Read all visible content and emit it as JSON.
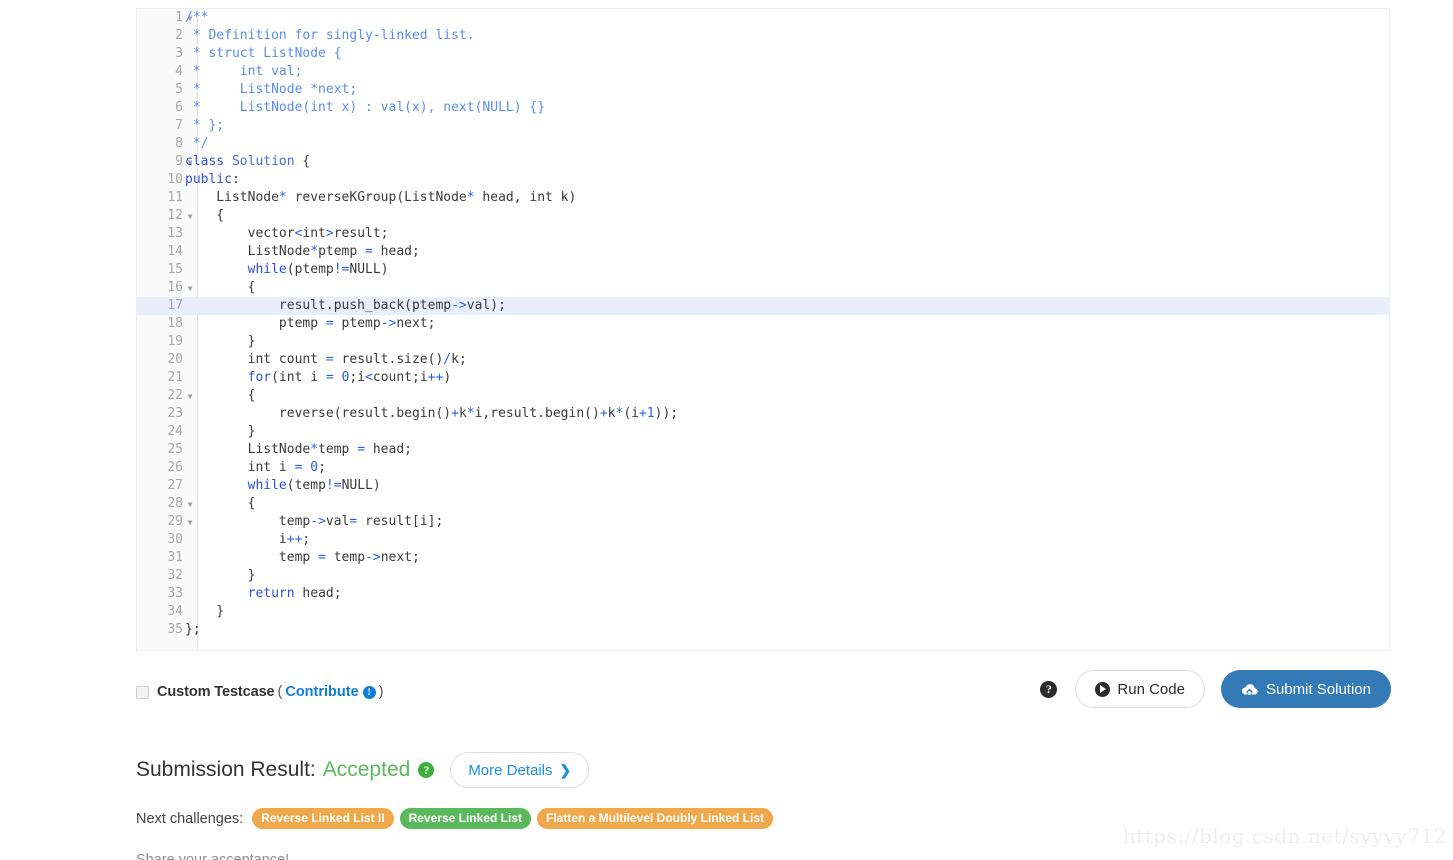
{
  "editor": {
    "language": "cpp",
    "active_line": 17,
    "lines": [
      {
        "n": 1,
        "fold": true,
        "tokens": [
          {
            "t": "/**",
            "c": "cmt"
          }
        ]
      },
      {
        "n": 2,
        "fold": false,
        "tokens": [
          {
            "t": " * Definition for singly-linked list.",
            "c": "cmt"
          }
        ]
      },
      {
        "n": 3,
        "fold": false,
        "tokens": [
          {
            "t": " * struct ListNode {",
            "c": "cmt"
          }
        ]
      },
      {
        "n": 4,
        "fold": false,
        "tokens": [
          {
            "t": " *     int val;",
            "c": "cmt"
          }
        ]
      },
      {
        "n": 5,
        "fold": false,
        "tokens": [
          {
            "t": " *     ListNode *next;",
            "c": "cmt"
          }
        ]
      },
      {
        "n": 6,
        "fold": false,
        "tokens": [
          {
            "t": " *     ListNode(int x) : val(x), next(NULL) {}",
            "c": "cmt"
          }
        ]
      },
      {
        "n": 7,
        "fold": false,
        "tokens": [
          {
            "t": " * };",
            "c": "cmt"
          }
        ]
      },
      {
        "n": 8,
        "fold": false,
        "tokens": [
          {
            "t": " */",
            "c": "cmt"
          }
        ]
      },
      {
        "n": 9,
        "fold": true,
        "tokens": [
          {
            "t": "class",
            "c": "kw"
          },
          {
            "t": " ",
            "c": "pln"
          },
          {
            "t": "Solution",
            "c": "cls"
          },
          {
            "t": " {",
            "c": "pln"
          }
        ]
      },
      {
        "n": 10,
        "fold": false,
        "tokens": [
          {
            "t": "public",
            "c": "kw"
          },
          {
            "t": ":",
            "c": "pln"
          }
        ]
      },
      {
        "n": 11,
        "fold": false,
        "tokens": [
          {
            "t": "    ListNode",
            "c": "pln"
          },
          {
            "t": "*",
            "c": "op"
          },
          {
            "t": " reverseKGroup(ListNode",
            "c": "pln"
          },
          {
            "t": "*",
            "c": "op"
          },
          {
            "t": " head, int k)",
            "c": "pln"
          }
        ]
      },
      {
        "n": 12,
        "fold": true,
        "tokens": [
          {
            "t": "    {",
            "c": "pln"
          }
        ]
      },
      {
        "n": 13,
        "fold": false,
        "tokens": [
          {
            "t": "        vector",
            "c": "pln"
          },
          {
            "t": "<",
            "c": "op"
          },
          {
            "t": "int",
            "c": "pln"
          },
          {
            "t": ">",
            "c": "op"
          },
          {
            "t": "result;",
            "c": "pln"
          }
        ]
      },
      {
        "n": 14,
        "fold": false,
        "tokens": [
          {
            "t": "        ListNode",
            "c": "pln"
          },
          {
            "t": "*",
            "c": "op"
          },
          {
            "t": "ptemp ",
            "c": "pln"
          },
          {
            "t": "=",
            "c": "op"
          },
          {
            "t": " head;",
            "c": "pln"
          }
        ]
      },
      {
        "n": 15,
        "fold": false,
        "tokens": [
          {
            "t": "        ",
            "c": "pln"
          },
          {
            "t": "while",
            "c": "kw"
          },
          {
            "t": "(ptemp",
            "c": "pln"
          },
          {
            "t": "!=",
            "c": "op"
          },
          {
            "t": "NULL)",
            "c": "pln"
          }
        ]
      },
      {
        "n": 16,
        "fold": true,
        "tokens": [
          {
            "t": "        {",
            "c": "pln"
          }
        ]
      },
      {
        "n": 17,
        "fold": false,
        "tokens": [
          {
            "t": "            result.push_back(ptemp",
            "c": "pln"
          },
          {
            "t": "->",
            "c": "op"
          },
          {
            "t": "val);",
            "c": "pln"
          }
        ]
      },
      {
        "n": 18,
        "fold": false,
        "tokens": [
          {
            "t": "            ptemp ",
            "c": "pln"
          },
          {
            "t": "=",
            "c": "op"
          },
          {
            "t": " ptemp",
            "c": "pln"
          },
          {
            "t": "->",
            "c": "op"
          },
          {
            "t": "next;",
            "c": "pln"
          }
        ]
      },
      {
        "n": 19,
        "fold": false,
        "tokens": [
          {
            "t": "        }",
            "c": "pln"
          }
        ]
      },
      {
        "n": 20,
        "fold": false,
        "tokens": [
          {
            "t": "        int count ",
            "c": "pln"
          },
          {
            "t": "=",
            "c": "op"
          },
          {
            "t": " result.size()",
            "c": "pln"
          },
          {
            "t": "/",
            "c": "op"
          },
          {
            "t": "k;",
            "c": "pln"
          }
        ]
      },
      {
        "n": 21,
        "fold": false,
        "tokens": [
          {
            "t": "        ",
            "c": "pln"
          },
          {
            "t": "for",
            "c": "kw"
          },
          {
            "t": "(int i ",
            "c": "pln"
          },
          {
            "t": "=",
            "c": "op"
          },
          {
            "t": " ",
            "c": "pln"
          },
          {
            "t": "0",
            "c": "num"
          },
          {
            "t": ";i",
            "c": "pln"
          },
          {
            "t": "<",
            "c": "op"
          },
          {
            "t": "count;i",
            "c": "pln"
          },
          {
            "t": "++",
            "c": "op"
          },
          {
            "t": ")",
            "c": "pln"
          }
        ]
      },
      {
        "n": 22,
        "fold": true,
        "tokens": [
          {
            "t": "        {",
            "c": "pln"
          }
        ]
      },
      {
        "n": 23,
        "fold": false,
        "tokens": [
          {
            "t": "            reverse(result.begin()",
            "c": "pln"
          },
          {
            "t": "+",
            "c": "op"
          },
          {
            "t": "k",
            "c": "pln"
          },
          {
            "t": "*",
            "c": "op"
          },
          {
            "t": "i,result.begin()",
            "c": "pln"
          },
          {
            "t": "+",
            "c": "op"
          },
          {
            "t": "k",
            "c": "pln"
          },
          {
            "t": "*",
            "c": "op"
          },
          {
            "t": "(i",
            "c": "pln"
          },
          {
            "t": "+",
            "c": "op"
          },
          {
            "t": "1",
            "c": "num"
          },
          {
            "t": "));",
            "c": "pln"
          }
        ]
      },
      {
        "n": 24,
        "fold": false,
        "tokens": [
          {
            "t": "        }",
            "c": "pln"
          }
        ]
      },
      {
        "n": 25,
        "fold": false,
        "tokens": [
          {
            "t": "        ListNode",
            "c": "pln"
          },
          {
            "t": "*",
            "c": "op"
          },
          {
            "t": "temp ",
            "c": "pln"
          },
          {
            "t": "=",
            "c": "op"
          },
          {
            "t": " head;",
            "c": "pln"
          }
        ]
      },
      {
        "n": 26,
        "fold": false,
        "tokens": [
          {
            "t": "        int i ",
            "c": "pln"
          },
          {
            "t": "=",
            "c": "op"
          },
          {
            "t": " ",
            "c": "pln"
          },
          {
            "t": "0",
            "c": "num"
          },
          {
            "t": ";",
            "c": "pln"
          }
        ]
      },
      {
        "n": 27,
        "fold": false,
        "tokens": [
          {
            "t": "        ",
            "c": "pln"
          },
          {
            "t": "while",
            "c": "kw"
          },
          {
            "t": "(temp",
            "c": "pln"
          },
          {
            "t": "!=",
            "c": "op"
          },
          {
            "t": "NULL)",
            "c": "pln"
          }
        ]
      },
      {
        "n": 28,
        "fold": true,
        "tokens": [
          {
            "t": "        {",
            "c": "pln"
          }
        ]
      },
      {
        "n": 29,
        "fold": true,
        "tokens": [
          {
            "t": "            temp",
            "c": "pln"
          },
          {
            "t": "->",
            "c": "op"
          },
          {
            "t": "val",
            "c": "pln"
          },
          {
            "t": "=",
            "c": "op"
          },
          {
            "t": " result[i];",
            "c": "pln"
          }
        ]
      },
      {
        "n": 30,
        "fold": false,
        "tokens": [
          {
            "t": "            i",
            "c": "pln"
          },
          {
            "t": "++",
            "c": "op"
          },
          {
            "t": ";",
            "c": "pln"
          }
        ]
      },
      {
        "n": 31,
        "fold": false,
        "tokens": [
          {
            "t": "            temp ",
            "c": "pln"
          },
          {
            "t": "=",
            "c": "op"
          },
          {
            "t": " temp",
            "c": "pln"
          },
          {
            "t": "->",
            "c": "op"
          },
          {
            "t": "next;",
            "c": "pln"
          }
        ]
      },
      {
        "n": 32,
        "fold": false,
        "tokens": [
          {
            "t": "        }",
            "c": "pln"
          }
        ]
      },
      {
        "n": 33,
        "fold": false,
        "tokens": [
          {
            "t": "        ",
            "c": "pln"
          },
          {
            "t": "return",
            "c": "kw"
          },
          {
            "t": " head;",
            "c": "pln"
          }
        ]
      },
      {
        "n": 34,
        "fold": false,
        "tokens": [
          {
            "t": "    }",
            "c": "pln"
          }
        ]
      },
      {
        "n": 35,
        "fold": false,
        "tokens": [
          {
            "t": "};",
            "c": "pln"
          }
        ]
      }
    ]
  },
  "action_bar": {
    "custom_testcase_label": "Custom Testcase",
    "custom_testcase_checked": false,
    "open_paren": "(",
    "contribute_label": "Contribute",
    "contribute_info_icon": "info-icon",
    "close_paren": ")",
    "help_icon": "question-mark-icon",
    "run_code_label": "Run Code",
    "run_code_icon": "play-circle-icon",
    "submit_label": "Submit Solution",
    "submit_icon": "cloud-upload-icon"
  },
  "result": {
    "title": "Submission Result:",
    "status": "Accepted",
    "status_color": "#5cb85c",
    "help_icon": "question-mark-circle-icon",
    "more_details_label": "More Details",
    "more_details_chevron": "chevron-right-icon",
    "next_challenges_label": "Next challenges:",
    "challenges": [
      {
        "label": "Reverse Linked List II",
        "color": "orange"
      },
      {
        "label": "Reverse Linked List",
        "color": "green"
      },
      {
        "label": "Flatten a Multilevel Doubly Linked List",
        "color": "orange"
      }
    ],
    "share_text": "Share your acceptance!"
  },
  "watermark": "https://blog.csdn.net/syyyy712"
}
